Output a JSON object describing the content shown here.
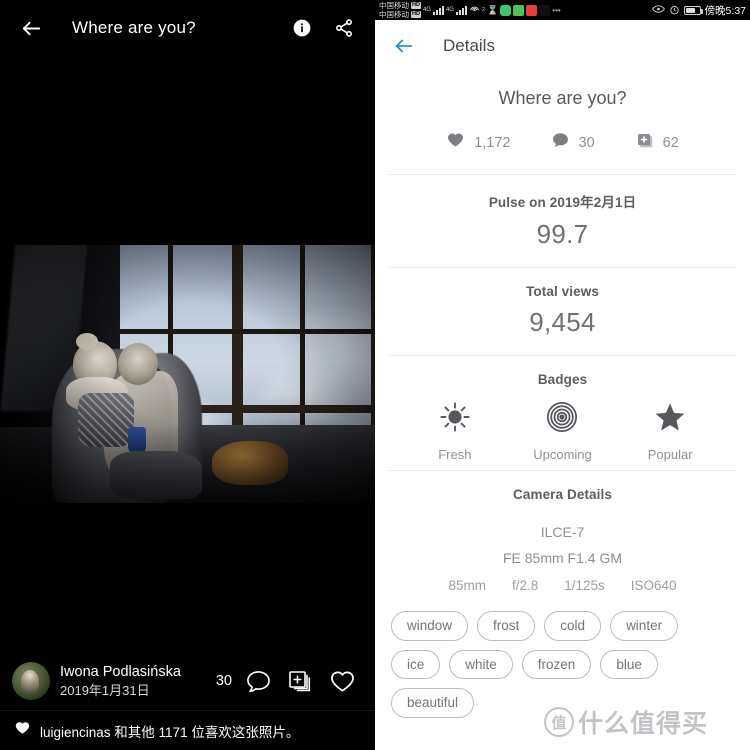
{
  "viewer": {
    "back_icon": "arrow-left-icon",
    "title": "Where are you?",
    "info_icon": "info-icon",
    "share_icon": "share-icon",
    "photo_alt": "Two children sitting on a windowsill looking out a frosted winter window",
    "author": {
      "name": "Iwona Podlasińska",
      "date": "2019年1月31日",
      "avatar_icon": "avatar"
    },
    "actions": {
      "comment_count": "30",
      "comment_icon": "comment-icon",
      "collect_icon": "add-to-collection-icon",
      "like_icon": "heart-outline-icon"
    },
    "likes_bar": {
      "heart_icon": "heart-filled-icon",
      "text": "luigiencinas 和其他 1171 位喜欢这张照片。"
    }
  },
  "statusbar": {
    "carrier_line1": "中国移动",
    "carrier_line2": "中国移动",
    "hd_badge": "HD",
    "net1": "4G",
    "net2": "4G",
    "wifi_label": "2",
    "icons": [
      "hourglass-icon",
      "heart-app-icon",
      "wechat-app-icon",
      "red-app-icon",
      "tiktok-app-icon",
      "more-icon"
    ],
    "right_icons": [
      "eye-icon",
      "alarm-icon",
      "battery-icon"
    ],
    "time": "傍晚5:37"
  },
  "details": {
    "back_icon": "arrow-left-icon",
    "header_title": "Details",
    "photo_title": "Where are you?",
    "stats": [
      {
        "icon": "heart-filled-icon",
        "value": "1,172",
        "name": "likes"
      },
      {
        "icon": "comment-filled-icon",
        "value": "30",
        "name": "comments"
      },
      {
        "icon": "add-to-collection-icon",
        "value": "62",
        "name": "collections"
      }
    ],
    "pulse": {
      "label": "Pulse on 2019年2月1日",
      "value": "99.7"
    },
    "views": {
      "label": "Total views",
      "value": "9,454"
    },
    "badges": {
      "label": "Badges",
      "items": [
        {
          "icon": "sun-icon",
          "label": "Fresh"
        },
        {
          "icon": "ripple-icon",
          "label": "Upcoming"
        },
        {
          "icon": "star-icon",
          "label": "Popular"
        }
      ]
    },
    "camera": {
      "label": "Camera Details",
      "body": "ILCE-7",
      "lens": "FE 85mm F1.4 GM",
      "exif": [
        "85mm",
        "f/2.8",
        "1/125s",
        "ISO640"
      ]
    },
    "tags": [
      "window",
      "frost",
      "cold",
      "winter",
      "ice",
      "white",
      "frozen",
      "blue",
      "beautiful"
    ]
  },
  "watermark": {
    "badge": "值",
    "text": "什么值得买"
  },
  "colors": {
    "accent": "#2196c4",
    "panel_bg": "#ffffff",
    "viewer_bg": "#000000",
    "text_muted": "#8b8f93"
  }
}
